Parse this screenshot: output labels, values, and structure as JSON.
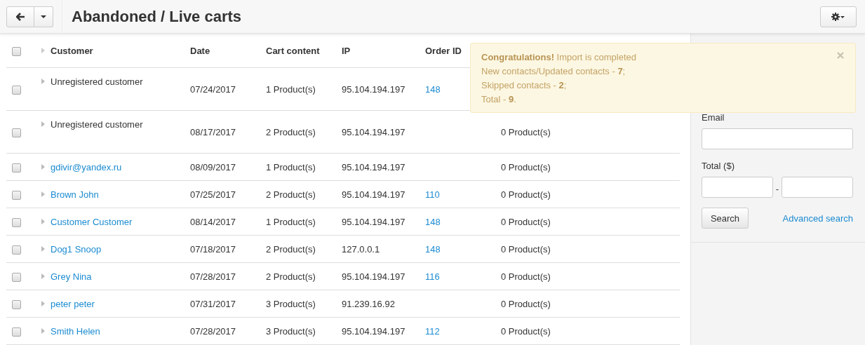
{
  "header": {
    "title": "Abandoned / Live carts"
  },
  "table": {
    "select_all_checked": false,
    "columns": [
      "Customer",
      "Date",
      "Cart content",
      "IP",
      "Order ID"
    ],
    "rows": [
      {
        "checked": false,
        "kind": "guest",
        "customer": "Unregistered customer",
        "date": "07/24/2017",
        "cart": "1 Product(s)",
        "ip": "95.104.194.197",
        "order_id": "148"
      },
      {
        "checked": false,
        "kind": "guest",
        "customer": "Unregistered customer",
        "date": "08/17/2017",
        "cart": "2 Product(s)",
        "ip": "95.104.194.197",
        "wishlist": "0 Product(s)"
      },
      {
        "checked": false,
        "kind": "registered",
        "customer": "gdivir@yandex.ru",
        "date": "08/09/2017",
        "cart": "1 Product(s)",
        "ip": "95.104.194.197",
        "wishlist": "0 Product(s)"
      },
      {
        "checked": false,
        "kind": "registered",
        "customer": "Brown John",
        "date": "07/25/2017",
        "cart": "2 Product(s)",
        "ip": "95.104.194.197",
        "order_id": "110",
        "wishlist": "0 Product(s)"
      },
      {
        "checked": false,
        "kind": "registered",
        "customer": "Customer Customer",
        "date": "08/14/2017",
        "cart": "1 Product(s)",
        "ip": "95.104.194.197",
        "order_id": "148",
        "wishlist": "0 Product(s)"
      },
      {
        "checked": false,
        "kind": "registered",
        "customer": "Dog1 Snoop",
        "date": "07/18/2017",
        "cart": "2 Product(s)",
        "ip": "127.0.0.1",
        "order_id": "148",
        "wishlist": "0 Product(s)"
      },
      {
        "checked": false,
        "kind": "registered",
        "customer": "Grey Nina",
        "date": "07/28/2017",
        "cart": "2 Product(s)",
        "ip": "95.104.194.197",
        "order_id": "116",
        "wishlist": "0 Product(s)"
      },
      {
        "checked": false,
        "kind": "registered",
        "customer": "peter peter",
        "date": "07/31/2017",
        "cart": "3 Product(s)",
        "ip": "91.239.16.92",
        "wishlist": "0 Product(s)"
      },
      {
        "checked": false,
        "kind": "registered",
        "customer": "Smith Helen",
        "date": "07/28/2017",
        "cart": "3 Product(s)",
        "ip": "95.104.194.197",
        "order_id": "112",
        "wishlist": "0 Product(s)"
      }
    ]
  },
  "sidebar": {
    "email_label": "Email",
    "total_label": "Total ($)",
    "range_separator": "-",
    "search_button": "Search",
    "advanced_link": "Advanced search"
  },
  "notification": {
    "lines": [
      "**Congratulations!** Import is completed",
      "New contacts/Updated contacts - **7**;",
      "Skipped contacts - **2**;",
      "Total - **9**."
    ]
  }
}
